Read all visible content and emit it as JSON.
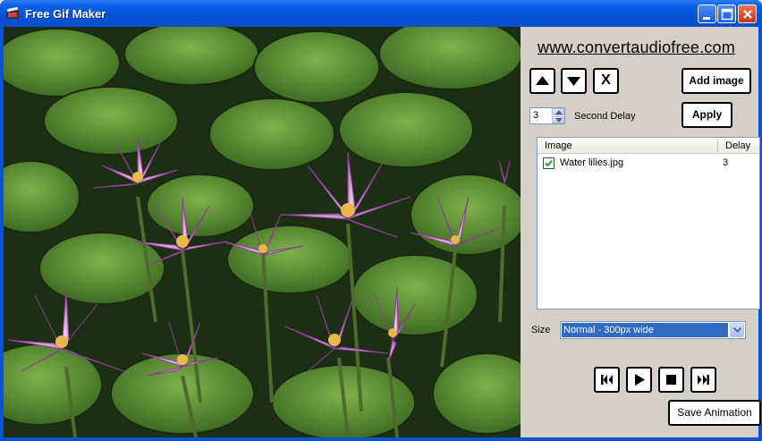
{
  "window": {
    "title": "Free Gif Maker"
  },
  "panel": {
    "site_link": "www.convertaudiofree.com",
    "buttons": {
      "up_icon": "arrow-up-icon",
      "down_icon": "arrow-down-icon",
      "remove": "X",
      "add_image": "Add image",
      "apply": "Apply",
      "save_animation": "Save Animation"
    },
    "delay": {
      "value": "3",
      "label": "Second Delay"
    },
    "list": {
      "headers": {
        "image": "Image",
        "delay": "Delay"
      },
      "rows": [
        {
          "name": "Water lilies.jpg",
          "delay": "3",
          "checked": true
        }
      ]
    },
    "size": {
      "label": "Size",
      "selected": "Normal - 300px wide"
    },
    "playback_icons": [
      "skip-first-icon",
      "play-icon",
      "stop-icon",
      "skip-last-icon"
    ]
  },
  "colors": {
    "titlebar": "#0a5ee6",
    "selection": "#316ac5",
    "panel_bg": "#d4d0c8"
  }
}
